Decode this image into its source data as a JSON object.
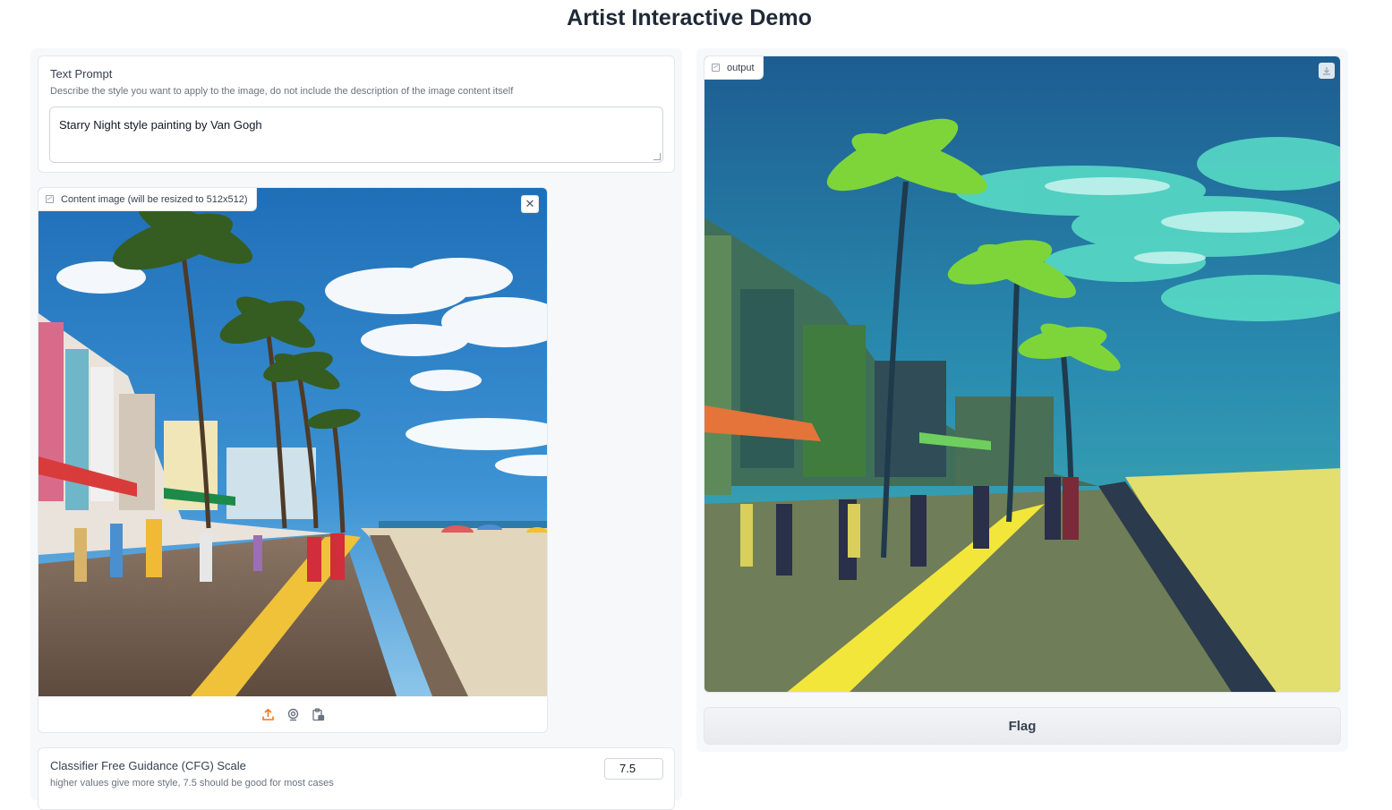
{
  "app": {
    "title": "Artist Interactive Demo"
  },
  "prompt": {
    "label": "Text Prompt",
    "info": "Describe the style you want to apply to the image, do not include the description of the image content itself",
    "value": "Starry Night style painting by Van Gogh"
  },
  "content_image": {
    "label": "Content image (will be resized to 512x512)",
    "close_icon": "close-icon",
    "sources": [
      "upload-icon",
      "webcam-icon",
      "clipboard-icon"
    ]
  },
  "cfg": {
    "label": "Classifier Free Guidance (CFG) Scale",
    "info": "higher values give more style, 7.5 should be good for most cases",
    "value": "7.5"
  },
  "output": {
    "label": "output",
    "download_icon": "download-icon"
  },
  "flag": {
    "label": "Flag"
  },
  "colors": {
    "accent": "#f97316",
    "text": "#1f2937",
    "panel_bg": "#f7f8fa"
  }
}
